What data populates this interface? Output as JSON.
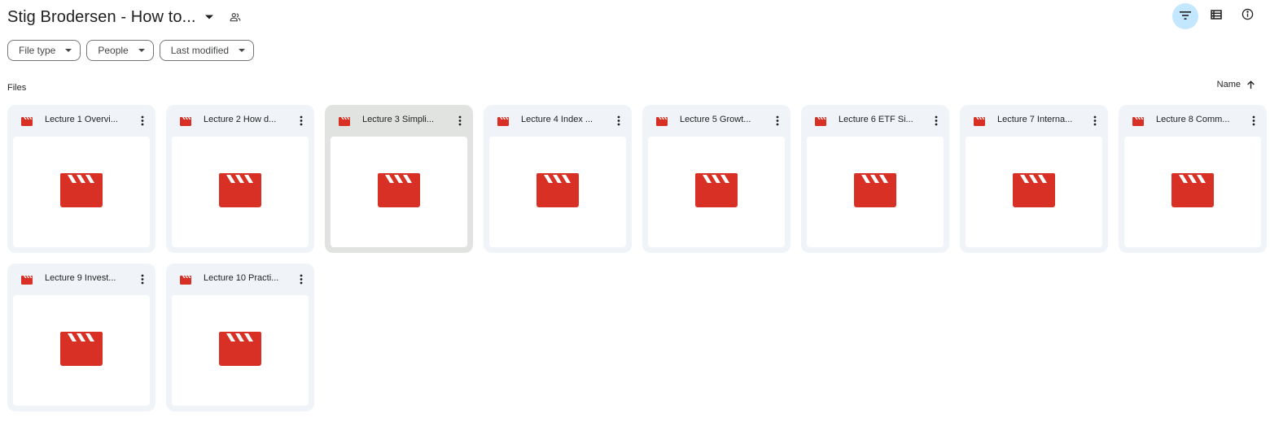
{
  "header": {
    "title": "Stig Brodersen - How to...",
    "title_caret_icon": "arrow-drop-down-icon",
    "shared_icon": "shared-people-icon"
  },
  "top_actions": [
    {
      "name": "filter-button",
      "icon": "filter-list-icon",
      "active": true
    },
    {
      "name": "list-view-button",
      "icon": "list-view-icon",
      "active": false
    },
    {
      "name": "details-button",
      "icon": "info-icon",
      "active": false
    }
  ],
  "filters": [
    {
      "label": "File type"
    },
    {
      "label": "People"
    },
    {
      "label": "Last modified"
    }
  ],
  "section": {
    "label": "Files",
    "sort_label": "Name",
    "sort_icon": "arrow-upward-icon"
  },
  "colors": {
    "video_red": "#d93025",
    "card_bg": "#f0f4f9",
    "card_hover": "#e1e3e1",
    "filter_active": "#c2e7ff"
  },
  "files": [
    {
      "name": "Lecture 1 Overvi...",
      "icon": "video-file-icon"
    },
    {
      "name": "Lecture 2 How d...",
      "icon": "video-file-icon"
    },
    {
      "name": "Lecture 3 Simpli...",
      "icon": "video-file-icon",
      "hover": true
    },
    {
      "name": "Lecture 4 Index ...",
      "icon": "video-file-icon"
    },
    {
      "name": "Lecture 5 Growt...",
      "icon": "video-file-icon"
    },
    {
      "name": "Lecture 6 ETF Si...",
      "icon": "video-file-icon"
    },
    {
      "name": "Lecture 7 Interna...",
      "icon": "video-file-icon"
    },
    {
      "name": "Lecture 8 Comm...",
      "icon": "video-file-icon"
    },
    {
      "name": "Lecture 9 Invest...",
      "icon": "video-file-icon"
    },
    {
      "name": "Lecture 10 Practi...",
      "icon": "video-file-icon"
    }
  ]
}
